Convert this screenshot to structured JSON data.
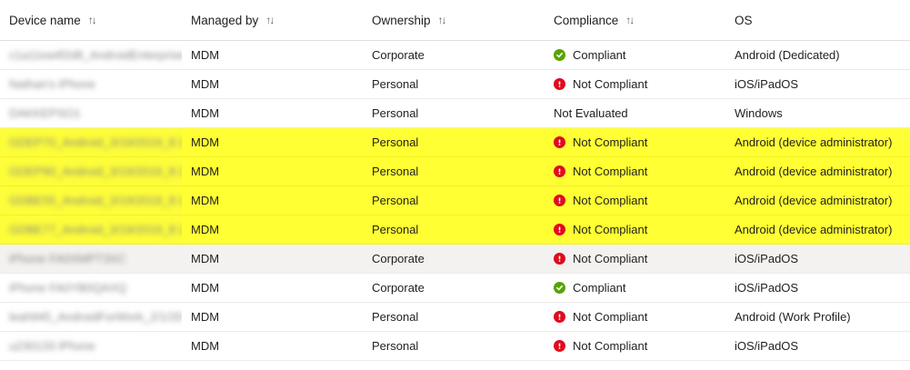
{
  "colors": {
    "compliant": "#57a300",
    "not_compliant": "#e00b1c",
    "highlight": "#ffff33",
    "selected_row": "#f3f2f1"
  },
  "columns": [
    {
      "label": "Device name",
      "sortable": true,
      "sort_icon": "sort-arrows-icon"
    },
    {
      "label": "Managed by",
      "sortable": true,
      "sort_icon": "sort-arrows-icon"
    },
    {
      "label": "Ownership",
      "sortable": true,
      "sort_icon": "sort-arrows-icon"
    },
    {
      "label": "Compliance",
      "sortable": true,
      "sort_icon": "sort-arrows-icon"
    },
    {
      "label": "OS",
      "sortable": false
    }
  ],
  "sort_glyph": "↑↓",
  "rows": [
    {
      "device": "c1a11ea4f2d8_AndroidEnterprise",
      "managed": "MDM",
      "ownership": "Corporate",
      "compliance": "Compliant",
      "status": "ok",
      "os": "Android (Dedicated)",
      "style": ""
    },
    {
      "device": "Nathan's iPhone",
      "managed": "MDM",
      "ownership": "Personal",
      "compliance": "Not Compliant",
      "status": "bad",
      "os": "iOS/iPadOS",
      "style": ""
    },
    {
      "device": "DAKKEPSO1",
      "managed": "MDM",
      "ownership": "Personal",
      "compliance": "Not Evaluated",
      "status": "none",
      "os": "Windows",
      "style": ""
    },
    {
      "device": "GDEP70_Android_3/19/2019_8:12",
      "managed": "MDM",
      "ownership": "Personal",
      "compliance": "Not Compliant",
      "status": "bad",
      "os": "Android (device administrator)",
      "style": "highlight"
    },
    {
      "device": "GDEP90_Android_3/19/2019_8:12",
      "managed": "MDM",
      "ownership": "Personal",
      "compliance": "Not Compliant",
      "status": "bad",
      "os": "Android (device administrator)",
      "style": "highlight"
    },
    {
      "device": "GDBE55_Android_3/19/2019_8:12",
      "managed": "MDM",
      "ownership": "Personal",
      "compliance": "Not Compliant",
      "status": "bad",
      "os": "Android (device administrator)",
      "style": "highlight"
    },
    {
      "device": "GDBE77_Android_3/19/2019_8:12",
      "managed": "MDM",
      "ownership": "Personal",
      "compliance": "Not Compliant",
      "status": "bad",
      "os": "Android (device administrator)",
      "style": "highlight"
    },
    {
      "device": "iPhone FA0XMPT3XC",
      "managed": "MDM",
      "ownership": "Corporate",
      "compliance": "Not Compliant",
      "status": "bad",
      "os": "iOS/iPadOS",
      "style": "selected"
    },
    {
      "device": "iPhone FA0YB0QAXQ",
      "managed": "MDM",
      "ownership": "Corporate",
      "compliance": "Compliant",
      "status": "ok",
      "os": "iOS/iPadOS",
      "style": ""
    },
    {
      "device": "leah945_AndroidForWork_2/1/20",
      "managed": "MDM",
      "ownership": "Personal",
      "compliance": "Not Compliant",
      "status": "bad",
      "os": "Android (Work Profile)",
      "style": ""
    },
    {
      "device": "u230133 iPhone",
      "managed": "MDM",
      "ownership": "Personal",
      "compliance": "Not Compliant",
      "status": "bad",
      "os": "iOS/iPadOS",
      "style": ""
    }
  ]
}
